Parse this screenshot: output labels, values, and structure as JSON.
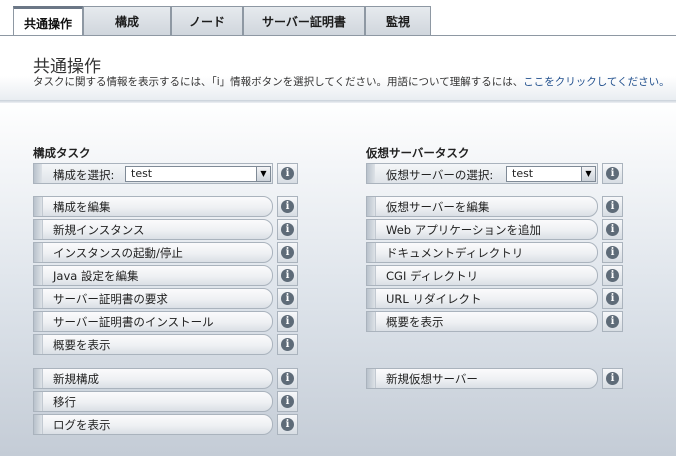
{
  "tabs": [
    {
      "label": "共通操作",
      "active": true
    },
    {
      "label": "構成",
      "active": false
    },
    {
      "label": "ノード",
      "active": false
    },
    {
      "label": "サーバー証明書",
      "active": false
    },
    {
      "label": "監視",
      "active": false
    }
  ],
  "header": {
    "title": "共通操作",
    "help_text": "タスクに関する情報を表示するには、「i」情報ボタンを選択してください。用語について理解するには、",
    "help_link": "ここをクリックしてください。"
  },
  "left": {
    "title": "構成タスク",
    "select_label": "構成を選択:",
    "select_value": "test",
    "group1": [
      "構成を編集",
      "新規インスタンス",
      "インスタンスの起動/停止",
      "Java 設定を編集",
      "サーバー証明書の要求",
      "サーバー証明書のインストール",
      "概要を表示"
    ],
    "group2": [
      "新規構成",
      "移行",
      "ログを表示"
    ]
  },
  "right": {
    "title": "仮想サーバータスク",
    "select_label": "仮想サーバーの選択:",
    "select_value": "test",
    "group1": [
      "仮想サーバーを編集",
      "Web アプリケーションを追加",
      "ドキュメントディレクトリ",
      "CGI ディレクトリ",
      "URL リダイレクト",
      "概要を表示"
    ],
    "group2": [
      "新規仮想サーバー"
    ]
  },
  "info_glyph": "i",
  "select_arrow_glyph": "▼",
  "icons": {
    "info": "info-icon",
    "dropdown": "chevron-down-icon"
  },
  "colors": {
    "link": "#1f4e8c",
    "active_tab_top": "#6b7786",
    "info_glyph_bg": "#5e6b78"
  }
}
